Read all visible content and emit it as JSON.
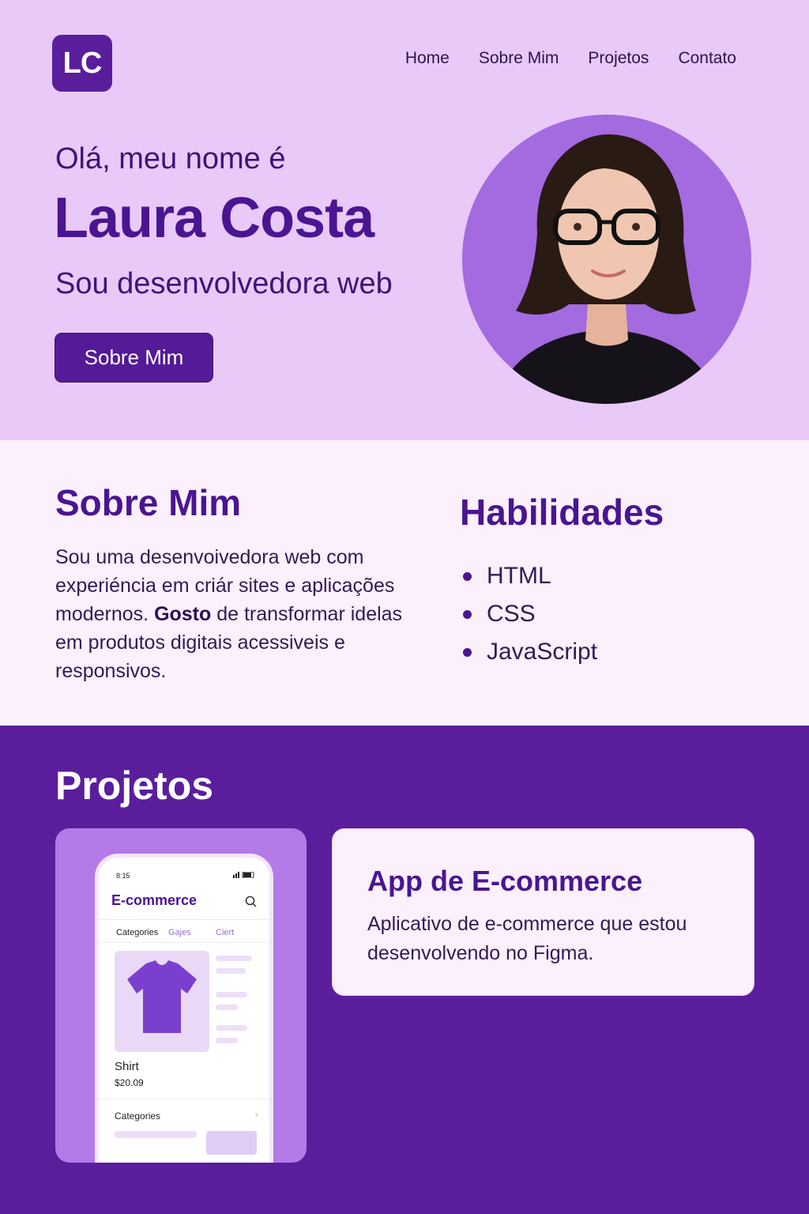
{
  "logo": {
    "text": "LC"
  },
  "nav": {
    "items": [
      "Home",
      "Sobre Mim",
      "Projetos",
      "Contato"
    ]
  },
  "hero": {
    "greeting": "Olá, meu nome é",
    "name": "Laura Costa",
    "tagline": "Sou desenvolvedora web",
    "button_label": "Sobre Mim"
  },
  "about": {
    "title": "Sobre Mim",
    "text_1": "Sou uma desenvoivedora web com experiéncia em criár sites e aplicações modernos. ",
    "text_bold": "Gosto",
    "text_2": " de transformar idelas em produtos digitais acessiveis e responsivos."
  },
  "skills": {
    "title": "Habilidades",
    "items": [
      "HTML",
      "CSS",
      "JavaScript"
    ]
  },
  "projects": {
    "title": "Projetos",
    "card": {
      "title": "App de E-commerce",
      "description": "Aplicativo de e-commerce que estou desenvolvendo no Figma."
    },
    "mockup": {
      "time": "8:15",
      "brand": "E-commerce",
      "tabs": [
        "Categories",
        "Gajes",
        "Ciert"
      ],
      "product_name": "Shirt",
      "product_price": "$20.09",
      "categories_label": "Categories"
    }
  },
  "colors": {
    "hero_bg": "#e8c9f8",
    "accent": "#5a1e9c",
    "about_bg": "#fcf0fc"
  }
}
